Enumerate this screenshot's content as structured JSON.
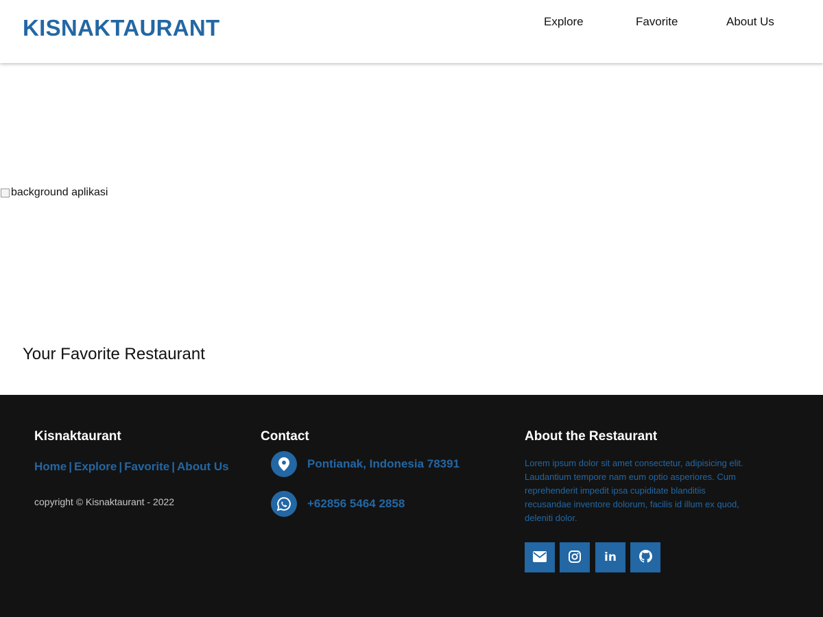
{
  "header": {
    "brand": "KISNAKTAURANT",
    "nav": [
      {
        "label": "Explore"
      },
      {
        "label": "Favorite"
      },
      {
        "label": "About Us"
      }
    ]
  },
  "hero": {
    "image_alt": "background aplikasi",
    "tagline": "Your Favorite Restaurant"
  },
  "footer": {
    "brand_title": "Kisnaktaurant",
    "links": [
      {
        "label": "Home"
      },
      {
        "label": "Explore"
      },
      {
        "label": "Favorite"
      },
      {
        "label": "About Us"
      }
    ],
    "link_separator": "|",
    "copyright": "copyright © Kisnaktaurant - 2022",
    "contact_title": "Contact",
    "contact": {
      "address": "Pontianak, Indonesia 78391",
      "address_icon": "map-marker-icon",
      "phone": "+62856 5464 2858",
      "phone_icon": "whatsapp-icon"
    },
    "about_title": "About the Restaurant",
    "about_text": "Lorem ipsum dolor sit amet consectetur, adipisicing elit. Laudantium tempore nam eum optio asperiores. Cum reprehenderit impedit ipsa cupiditate blanditiis recusandae inventore dolorum, facilis id illum ex quod, deleniti dolor.",
    "social": [
      {
        "icon": "envelope-icon"
      },
      {
        "icon": "instagram-icon"
      },
      {
        "icon": "linkedin-icon",
        "glyph": "in"
      },
      {
        "icon": "github-icon"
      }
    ]
  },
  "colors": {
    "accent": "#2367a4",
    "footer_bg": "#131313",
    "header_bg": "#ffffff"
  }
}
